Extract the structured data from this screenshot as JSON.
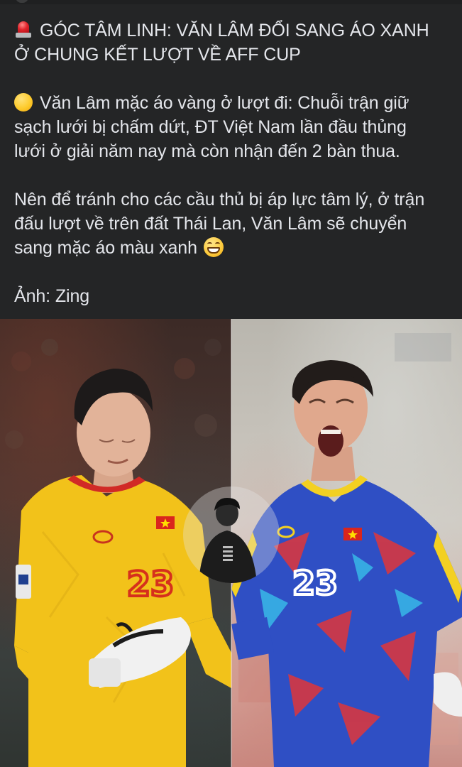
{
  "post": {
    "title_line_1": "GÓC TÂM LINH: VĂN LÂM ĐỔI SANG ÁO XANH",
    "title_line_2": "Ở CHUNG KẾT LƯỢT VỀ AFF CUP",
    "para2_line_1": "Văn Lâm mặc áo vàng ở lượt đi: Chuỗi trận giữ",
    "para2_line_2": "sạch lưới bị chấm dứt, ĐT Việt Nam lần đầu thủng",
    "para2_line_3": "lưới ở giải năm nay mà còn nhận đến 2 bàn thua.",
    "para3_line_1": "Nên để tránh cho các cầu thủ bị áp lực tâm lý, ở trận",
    "para3_line_2": "đấu lượt về trên đất Thái Lan, Văn Lâm sẽ chuyển",
    "para3_line_3": "sang mặc áo màu xanh",
    "credit": "Ảnh: Zing"
  },
  "photo": {
    "left_jersey_number": "23",
    "right_jersey_number": "23"
  },
  "icons": {
    "title_emoji": "police-car-light-icon",
    "para2_emoji": "yellow-circle-icon",
    "para3_emoji": "grinning-face-icon"
  },
  "colors": {
    "background": "#242526",
    "text": "#e4e6eb",
    "yellow_kit": "#f5c518",
    "blue_kit": "#2f4fc4"
  }
}
